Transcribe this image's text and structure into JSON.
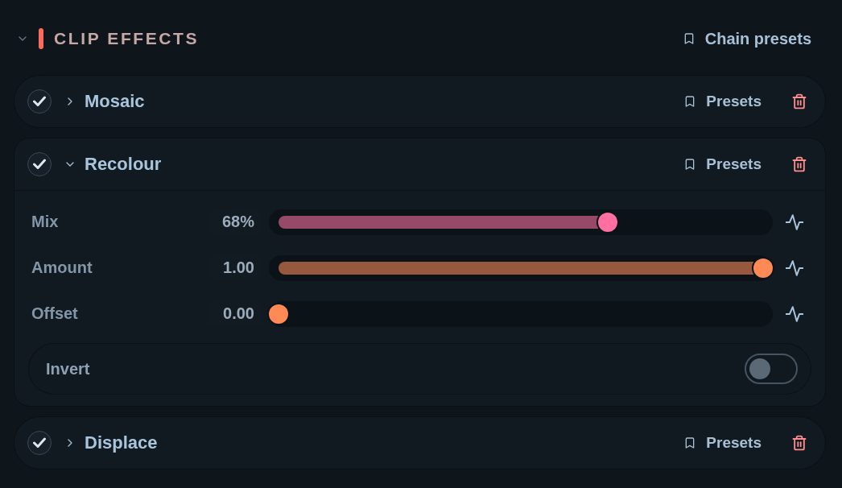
{
  "section": {
    "title": "CLIP EFFECTS",
    "expanded": true,
    "chain_presets": "Chain presets"
  },
  "effects": [
    {
      "name": "Mosaic",
      "enabled": true,
      "expanded": false,
      "presets": "Presets"
    },
    {
      "name": "Recolour",
      "enabled": true,
      "expanded": true,
      "presets": "Presets",
      "params": [
        {
          "kind": "slider",
          "label": "Mix",
          "value": "68%",
          "level": 0.68,
          "color": "#ff6f9f"
        },
        {
          "kind": "slider",
          "label": "Amount",
          "value": "1.00",
          "level": 1,
          "color": "#ff8a55"
        },
        {
          "kind": "slider",
          "label": "Offset",
          "value": "0.00",
          "level": 0,
          "color": "#ff8a55"
        },
        {
          "kind": "toggle",
          "label": "Invert",
          "on": false
        }
      ]
    },
    {
      "name": "Displace",
      "enabled": true,
      "expanded": false,
      "presets": "Presets"
    }
  ]
}
